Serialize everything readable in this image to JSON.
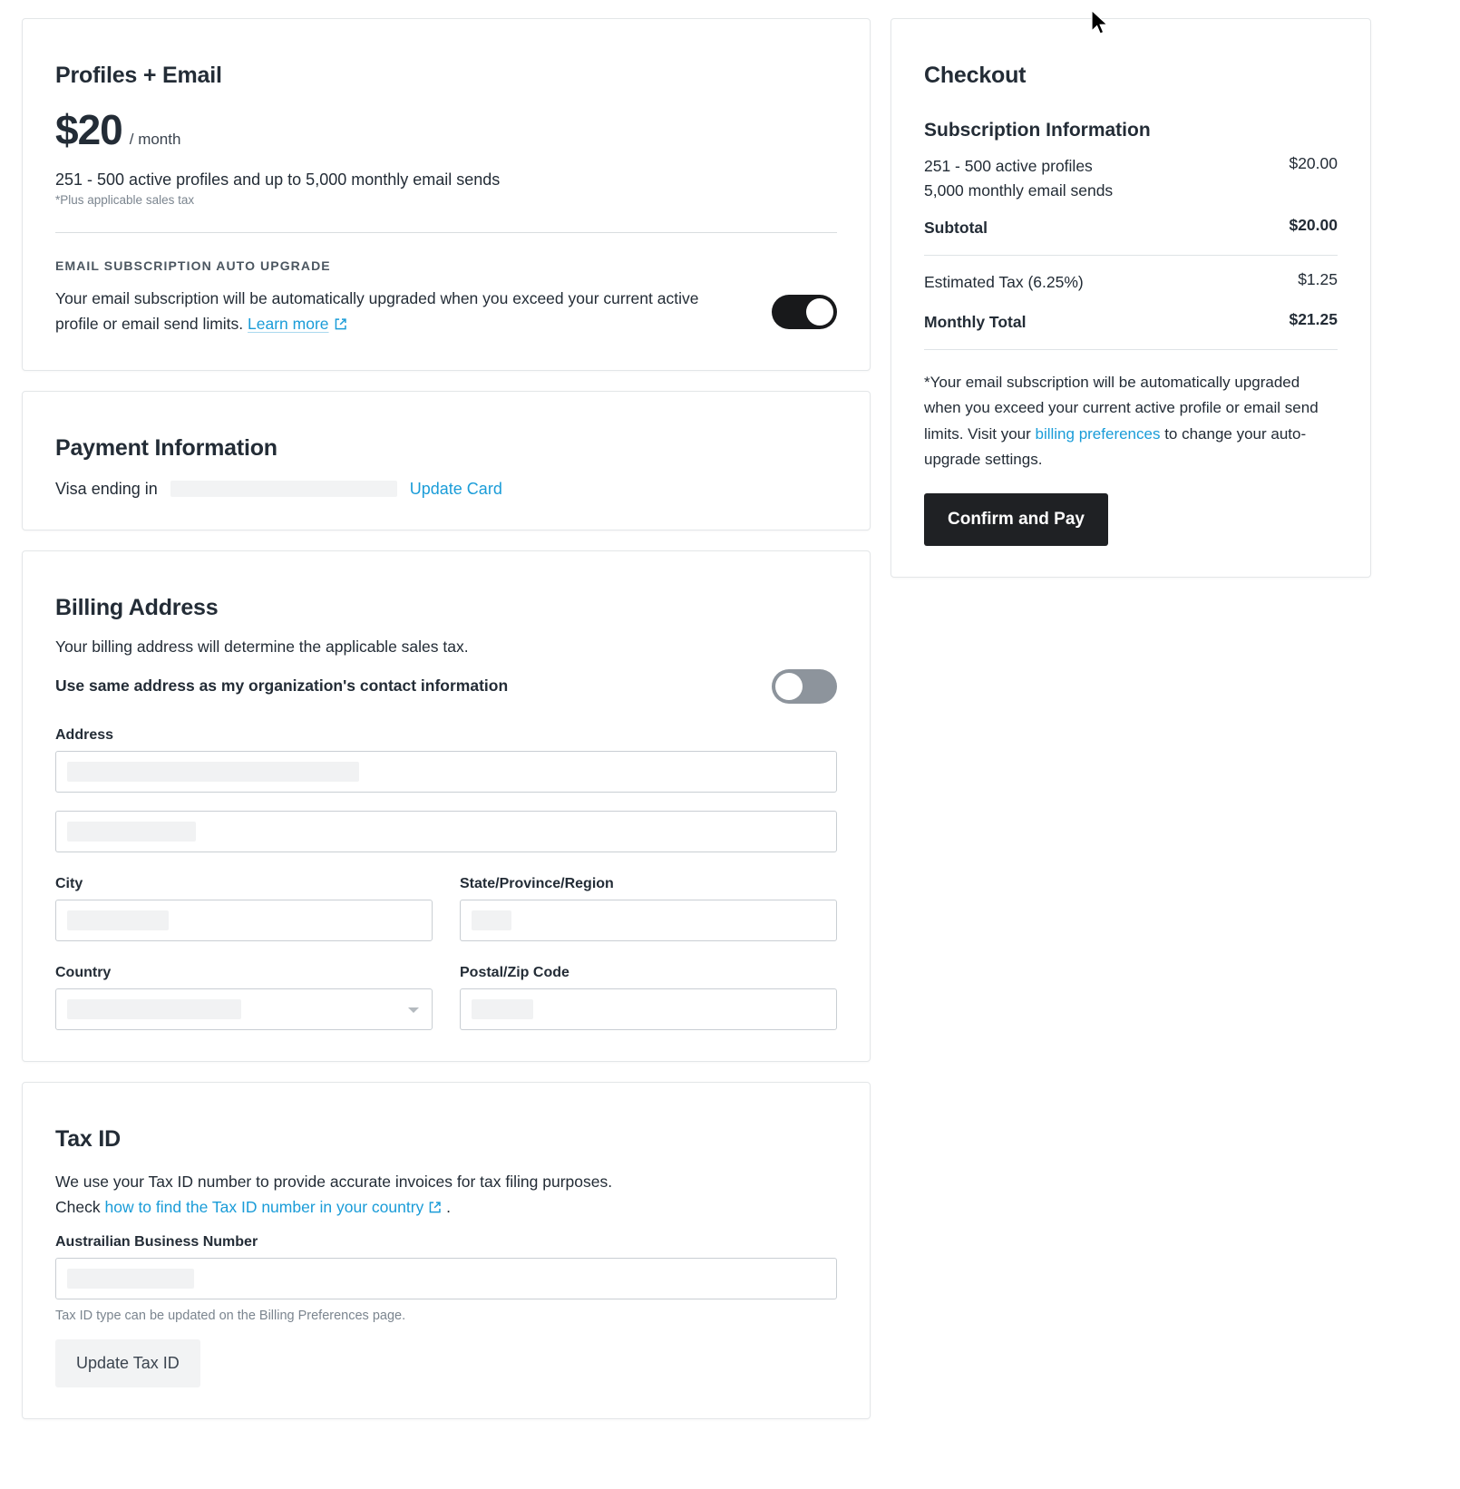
{
  "plan": {
    "title": "Profiles + Email",
    "price_amount": "$20",
    "price_period": "/ month",
    "description": "251 - 500 active profiles and up to 5,000 monthly email sends",
    "tax_note": "*Plus applicable sales tax",
    "auto_upgrade_eyebrow": "EMAIL SUBSCRIPTION AUTO UPGRADE",
    "auto_upgrade_text": "Your email subscription will be automatically upgraded when you exceed your current active profile or email send limits.",
    "learn_more_label": "Learn more",
    "toggle_state": "on"
  },
  "payment": {
    "title": "Payment Information",
    "card_label": "Visa ending in",
    "card_digits": "",
    "update_card_label": "Update Card"
  },
  "billing": {
    "title": "Billing Address",
    "description": "Your billing address will determine the applicable sales tax.",
    "same_address_label": "Use same address as my organization's contact information",
    "same_address_toggle_state": "off",
    "address_label": "Address",
    "address_line1_value": "",
    "address_line2_value": "",
    "city_label": "City",
    "city_value": "",
    "state_label": "State/Province/Region",
    "state_value": "",
    "country_label": "Country",
    "country_value": "",
    "postal_label": "Postal/Zip Code",
    "postal_value": ""
  },
  "tax_id": {
    "title": "Tax ID",
    "description": "We use your Tax ID number to provide accurate invoices for tax filing purposes.",
    "check_prefix": "Check",
    "check_link_label": "how to find the Tax ID number in your country",
    "check_suffix": ".",
    "field_label": "Austrailian Business Number",
    "field_value": "",
    "hint": "Tax ID type can be updated on the Billing Preferences page.",
    "update_button_label": "Update Tax ID"
  },
  "checkout": {
    "title": "Checkout",
    "section_title": "Subscription Information",
    "lines": [
      {
        "label": "251 - 500 active profiles\n5,000 monthly email sends",
        "value": "$20.00",
        "strong": false
      },
      {
        "label": "Subtotal",
        "value": "$20.00",
        "strong": true
      }
    ],
    "line_profiles_1": "251 - 500 active profiles",
    "line_profiles_2": "5,000 monthly email sends",
    "line_profiles_value": "$20.00",
    "subtotal_label": "Subtotal",
    "subtotal_value": "$20.00",
    "tax_label": "Estimated Tax (6.25%)",
    "tax_value": "$1.25",
    "total_label": "Monthly Total",
    "total_value": "$21.25",
    "disclaimer_part1": "*Your email subscription will be automatically upgraded when you exceed your current active profile or email send limits. Visit your ",
    "disclaimer_link": "billing preferences",
    "disclaimer_part2": " to change your auto-upgrade settings.",
    "confirm_button_label": "Confirm and Pay"
  },
  "colors": {
    "link": "#1a9cd8",
    "toggle_on": "#18191b",
    "toggle_off": "#8d949c",
    "primary_button": "#1f2124",
    "text": "#232c36"
  },
  "icons": {
    "external_link": "external-link-icon",
    "chevron_down": "chevron-down-icon",
    "cursor": "mouse-cursor"
  }
}
